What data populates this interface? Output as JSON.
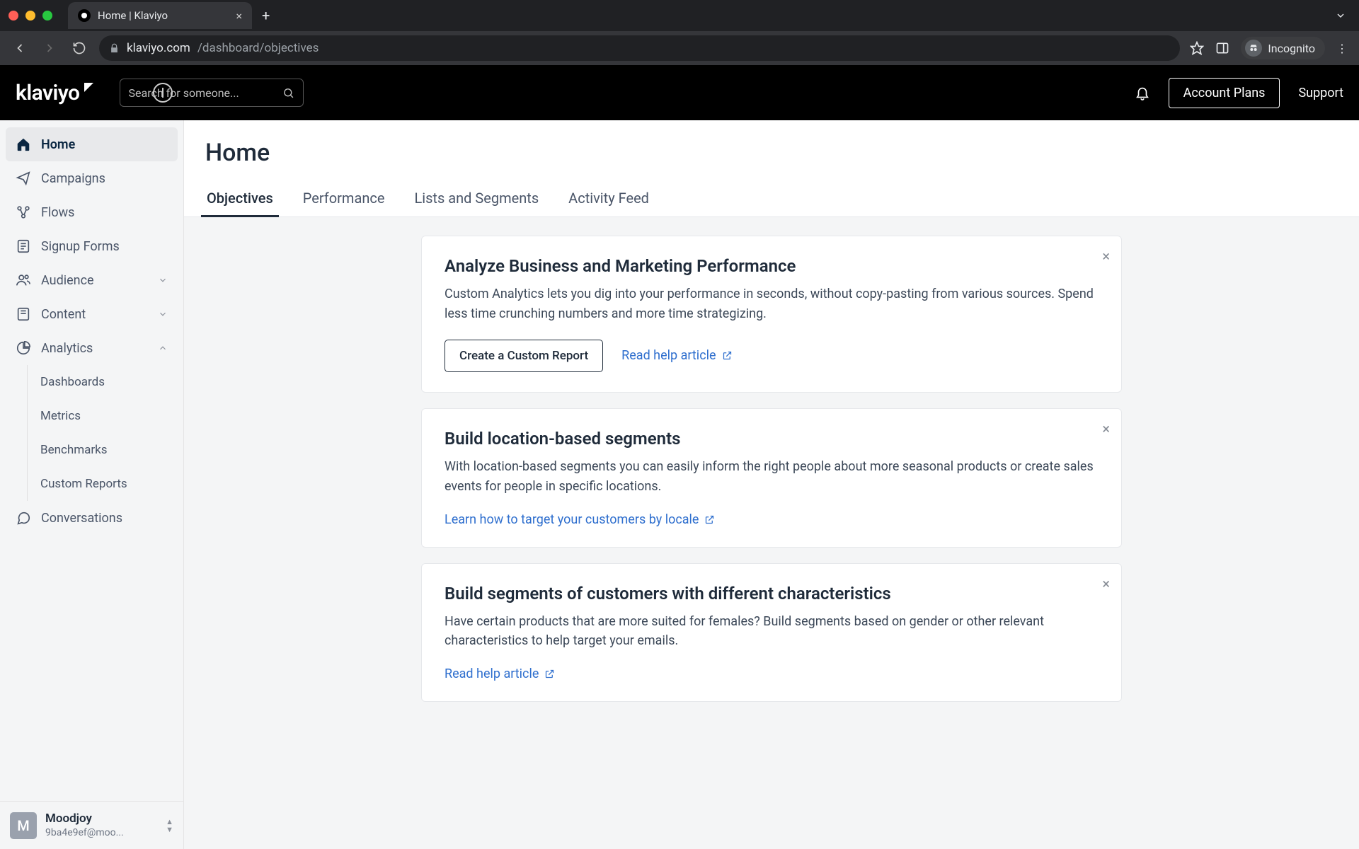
{
  "browser": {
    "tab_title": "Home | Klaviyo",
    "url_host": "klaviyo.com",
    "url_path": "/dashboard/objectives",
    "incognito_label": "Incognito"
  },
  "header": {
    "logo": "klaviyo",
    "search_placeholder": "Search for someone...",
    "account_plans": "Account Plans",
    "support": "Support"
  },
  "sidebar": {
    "items": [
      {
        "label": "Home",
        "icon": "home-icon"
      },
      {
        "label": "Campaigns",
        "icon": "campaigns-icon"
      },
      {
        "label": "Flows",
        "icon": "flows-icon"
      },
      {
        "label": "Signup Forms",
        "icon": "forms-icon"
      },
      {
        "label": "Audience",
        "icon": "audience-icon"
      },
      {
        "label": "Content",
        "icon": "content-icon"
      },
      {
        "label": "Analytics",
        "icon": "analytics-icon"
      },
      {
        "label": "Conversations",
        "icon": "conversations-icon"
      }
    ],
    "analytics_children": [
      {
        "label": "Dashboards"
      },
      {
        "label": "Metrics"
      },
      {
        "label": "Benchmarks"
      },
      {
        "label": "Custom Reports"
      }
    ],
    "profile": {
      "initial": "M",
      "name": "Moodjoy",
      "email": "9ba4e9ef@moo..."
    }
  },
  "page": {
    "title": "Home",
    "tabs": [
      {
        "label": "Objectives"
      },
      {
        "label": "Performance"
      },
      {
        "label": "Lists and Segments"
      },
      {
        "label": "Activity Feed"
      }
    ],
    "cards": [
      {
        "title": "Analyze Business and Marketing Performance",
        "body": "Custom Analytics lets you dig into your performance in seconds, without copy-pasting from various sources. Spend less time crunching numbers and more time strategizing.",
        "primary_action": "Create a Custom Report",
        "link": "Read help article"
      },
      {
        "title": "Build location-based segments",
        "body": "With location-based segments you can easily inform the right people about more seasonal products or create sales events for people in specific locations.",
        "link": "Learn how to target your customers by locale"
      },
      {
        "title": "Build segments of customers with different characteristics",
        "body": "Have certain products that are more suited for females? Build segments based on gender or other relevant characteristics to help target your emails.",
        "link": "Read help article"
      }
    ]
  }
}
